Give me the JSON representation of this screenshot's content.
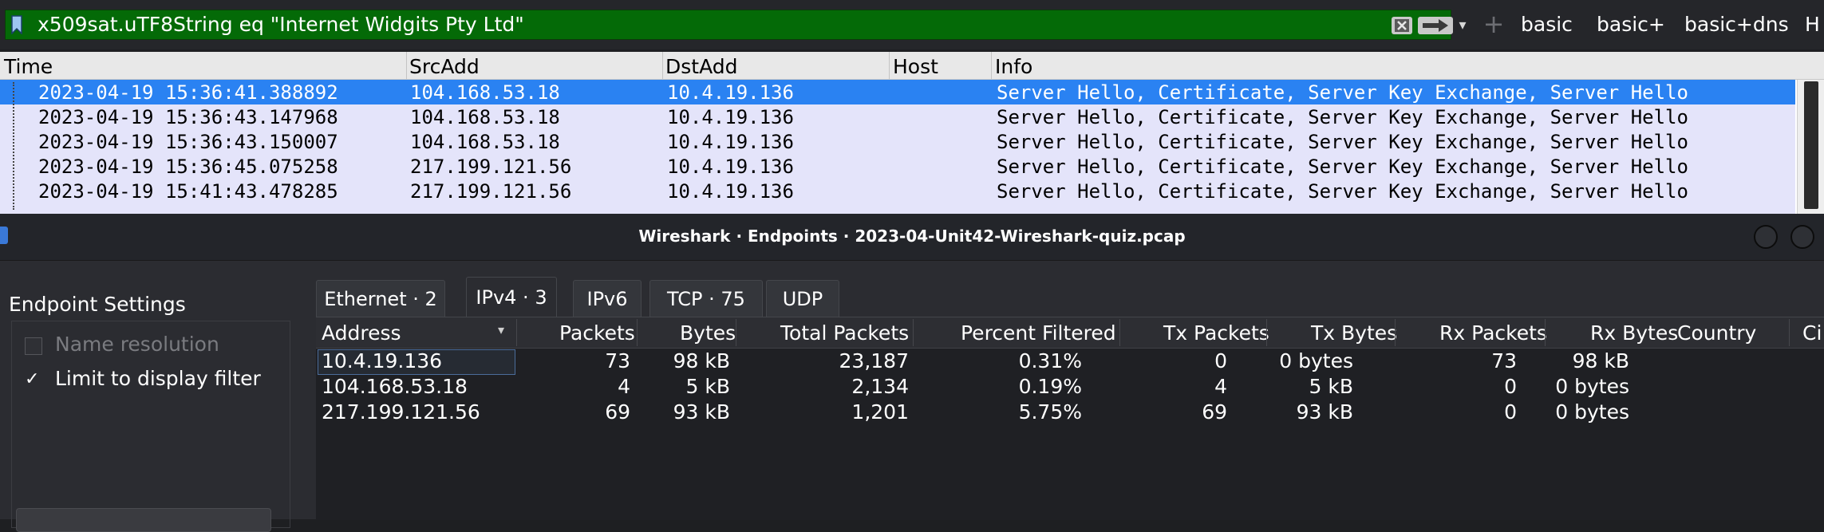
{
  "filter": {
    "text": "x509sat.uTF8String eq \"Internet Widgits Pty Ltd\"",
    "buttons": [
      "basic",
      "basic+",
      "basic+dns",
      "H"
    ]
  },
  "packet_list": {
    "columns": [
      "Time",
      "SrcAdd",
      "DstAdd",
      "Host",
      "Info"
    ],
    "rows": [
      {
        "time": "2023-04-19 15:36:41.388892",
        "src": "104.168.53.18",
        "dst": "10.4.19.136",
        "host": "",
        "info": "Server Hello, Certificate, Server Key Exchange, Server Hello"
      },
      {
        "time": "2023-04-19 15:36:43.147968",
        "src": "104.168.53.18",
        "dst": "10.4.19.136",
        "host": "",
        "info": "Server Hello, Certificate, Server Key Exchange, Server Hello"
      },
      {
        "time": "2023-04-19 15:36:43.150007",
        "src": "104.168.53.18",
        "dst": "10.4.19.136",
        "host": "",
        "info": "Server Hello, Certificate, Server Key Exchange, Server Hello"
      },
      {
        "time": "2023-04-19 15:36:45.075258",
        "src": "217.199.121.56",
        "dst": "10.4.19.136",
        "host": "",
        "info": "Server Hello, Certificate, Server Key Exchange, Server Hello"
      },
      {
        "time": "2023-04-19 15:41:43.478285",
        "src": "217.199.121.56",
        "dst": "10.4.19.136",
        "host": "",
        "info": "Server Hello, Certificate, Server Key Exchange, Server Hello"
      }
    ]
  },
  "dialog": {
    "title": "Wireshark · Endpoints · 2023-04-Unit42-Wireshark-quiz.pcap",
    "settings_title": "Endpoint Settings",
    "name_resolution": "Name resolution",
    "limit_filter": "Limit to display filter",
    "limit_checked": true,
    "tabs": [
      "Ethernet · 2",
      "IPv4 · 3",
      "IPv6",
      "TCP · 75",
      "UDP"
    ],
    "active_tab": "IPv4 · 3",
    "columns": [
      "Address",
      "Packets",
      "Bytes",
      "Total Packets",
      "Percent Filtered",
      "Tx Packets",
      "Tx Bytes",
      "Rx Packets",
      "Rx Bytes",
      "Country",
      "Ci"
    ],
    "rows": [
      {
        "address": "10.4.19.136",
        "packets": "73",
        "bytes": "98 kB",
        "total": "23,187",
        "pct": "0.31%",
        "txp": "0",
        "txb": "0 bytes",
        "rxp": "73",
        "rxb": "98 kB"
      },
      {
        "address": "104.168.53.18",
        "packets": "4",
        "bytes": "5 kB",
        "total": "2,134",
        "pct": "0.19%",
        "txp": "4",
        "txb": "5 kB",
        "rxp": "0",
        "rxb": "0 bytes"
      },
      {
        "address": "217.199.121.56",
        "packets": "69",
        "bytes": "93 kB",
        "total": "1,201",
        "pct": "5.75%",
        "txp": "69",
        "txb": "93 kB",
        "rxp": "0",
        "rxb": "0 bytes"
      }
    ]
  }
}
